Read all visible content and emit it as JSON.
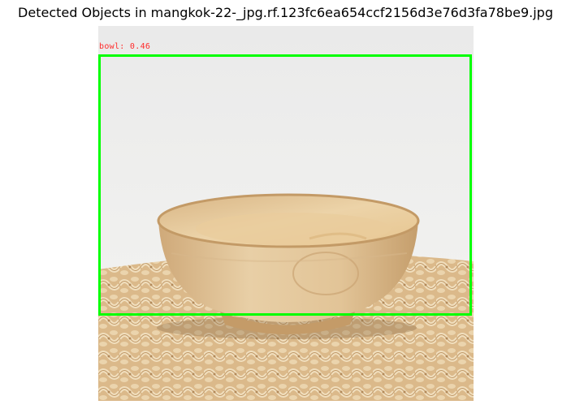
{
  "figure": {
    "title": "Detected Objects in mangkok-22-_jpg.rf.123fc6ea654ccf2156d3e76d3fa78be9.jpg"
  },
  "detections": [
    {
      "label_text": "bowl: 0.46",
      "class_name": "bowl",
      "confidence": 0.46,
      "box_color": "#00ff00",
      "label_color": "#ff2a2a"
    }
  ],
  "scene": {
    "subject": "wooden bowl",
    "surface": "woven water hyacinth placemat",
    "background_color": "#eeeeec",
    "wood_color": "#e2c597",
    "mat_color": "#d9b47c"
  }
}
